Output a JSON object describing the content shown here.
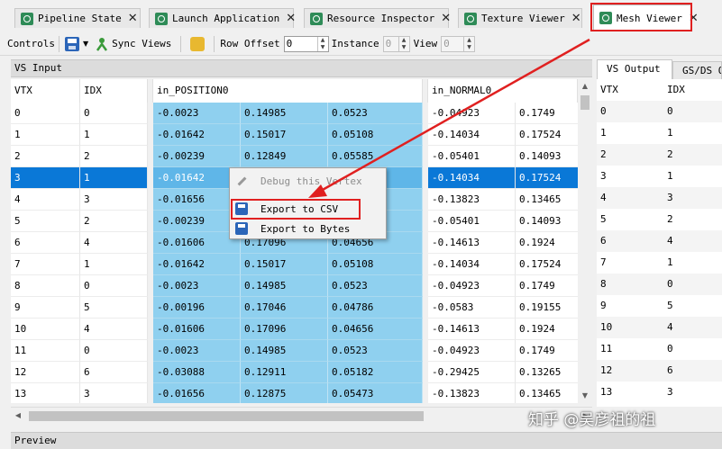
{
  "tabs": [
    {
      "label": "Pipeline State",
      "active": false
    },
    {
      "label": "Launch Application",
      "active": false
    },
    {
      "label": "Resource Inspector",
      "active": false
    },
    {
      "label": "Texture Viewer",
      "active": false
    },
    {
      "label": "Mesh Viewer",
      "active": true
    }
  ],
  "toolbar": {
    "controls_label": "Controls",
    "sync_views_label": "Sync Views",
    "row_offset_label": "Row Offset",
    "row_offset_value": "0",
    "instance_label": "Instance",
    "instance_value": "0",
    "view_label": "View",
    "view_value": "0"
  },
  "vs_input": {
    "title": "VS Input",
    "columns": {
      "vtx": "VTX",
      "idx": "IDX",
      "position": "in_POSITION0",
      "normal": "in_NORMAL0"
    },
    "rows": [
      {
        "vtx": "0",
        "idx": "0",
        "pos": [
          "-0.0023",
          "0.14985",
          "0.0523"
        ],
        "norm": [
          "-0.04923",
          "0.1749"
        ]
      },
      {
        "vtx": "1",
        "idx": "1",
        "pos": [
          "-0.01642",
          "0.15017",
          "0.05108"
        ],
        "norm": [
          "-0.14034",
          "0.17524"
        ]
      },
      {
        "vtx": "2",
        "idx": "2",
        "pos": [
          "-0.00239",
          "0.12849",
          "0.05585"
        ],
        "norm": [
          "-0.05401",
          "0.14093"
        ]
      },
      {
        "vtx": "3",
        "idx": "1",
        "pos": [
          "-0.01642",
          "",
          ""
        ],
        "norm": [
          "-0.14034",
          "0.17524"
        ],
        "selected": true
      },
      {
        "vtx": "4",
        "idx": "3",
        "pos": [
          "-0.01656",
          "",
          ""
        ],
        "norm": [
          "-0.13823",
          "0.13465"
        ]
      },
      {
        "vtx": "5",
        "idx": "2",
        "pos": [
          "-0.00239",
          "",
          ""
        ],
        "norm": [
          "-0.05401",
          "0.14093"
        ]
      },
      {
        "vtx": "6",
        "idx": "4",
        "pos": [
          "-0.01606",
          "0.17096",
          "0.04656"
        ],
        "norm": [
          "-0.14613",
          "0.1924"
        ]
      },
      {
        "vtx": "7",
        "idx": "1",
        "pos": [
          "-0.01642",
          "0.15017",
          "0.05108"
        ],
        "norm": [
          "-0.14034",
          "0.17524"
        ]
      },
      {
        "vtx": "8",
        "idx": "0",
        "pos": [
          "-0.0023",
          "0.14985",
          "0.0523"
        ],
        "norm": [
          "-0.04923",
          "0.1749"
        ]
      },
      {
        "vtx": "9",
        "idx": "5",
        "pos": [
          "-0.00196",
          "0.17046",
          "0.04786"
        ],
        "norm": [
          "-0.0583",
          "0.19155"
        ]
      },
      {
        "vtx": "10",
        "idx": "4",
        "pos": [
          "-0.01606",
          "0.17096",
          "0.04656"
        ],
        "norm": [
          "-0.14613",
          "0.1924"
        ]
      },
      {
        "vtx": "11",
        "idx": "0",
        "pos": [
          "-0.0023",
          "0.14985",
          "0.0523"
        ],
        "norm": [
          "-0.04923",
          "0.1749"
        ]
      },
      {
        "vtx": "12",
        "idx": "6",
        "pos": [
          "-0.03088",
          "0.12911",
          "0.05182"
        ],
        "norm": [
          "-0.29425",
          "0.13265"
        ]
      },
      {
        "vtx": "13",
        "idx": "3",
        "pos": [
          "-0.01656",
          "0.12875",
          "0.05473"
        ],
        "norm": [
          "-0.13823",
          "0.13465"
        ]
      }
    ]
  },
  "vs_output": {
    "tabs": [
      "VS Output",
      "GS/DS O"
    ],
    "columns": {
      "vtx": "VTX",
      "idx": "IDX"
    },
    "rows": [
      {
        "vtx": "0",
        "idx": "0"
      },
      {
        "vtx": "1",
        "idx": "1"
      },
      {
        "vtx": "2",
        "idx": "2"
      },
      {
        "vtx": "3",
        "idx": "1"
      },
      {
        "vtx": "4",
        "idx": "3"
      },
      {
        "vtx": "5",
        "idx": "2"
      },
      {
        "vtx": "6",
        "idx": "4"
      },
      {
        "vtx": "7",
        "idx": "1"
      },
      {
        "vtx": "8",
        "idx": "0"
      },
      {
        "vtx": "9",
        "idx": "5"
      },
      {
        "vtx": "10",
        "idx": "4"
      },
      {
        "vtx": "11",
        "idx": "0"
      },
      {
        "vtx": "12",
        "idx": "6"
      },
      {
        "vtx": "13",
        "idx": "3"
      }
    ]
  },
  "context_menu": {
    "debug_vertex": "Debug this Vertex",
    "export_csv": "Export to CSV",
    "export_bytes": "Export to Bytes"
  },
  "preview_label": "Preview",
  "watermark": "知乎 @吴彦祖的祖",
  "colors": {
    "position_cells": "#8fd0ef",
    "selection": "#0a78d7",
    "annotation": "#e02020"
  }
}
